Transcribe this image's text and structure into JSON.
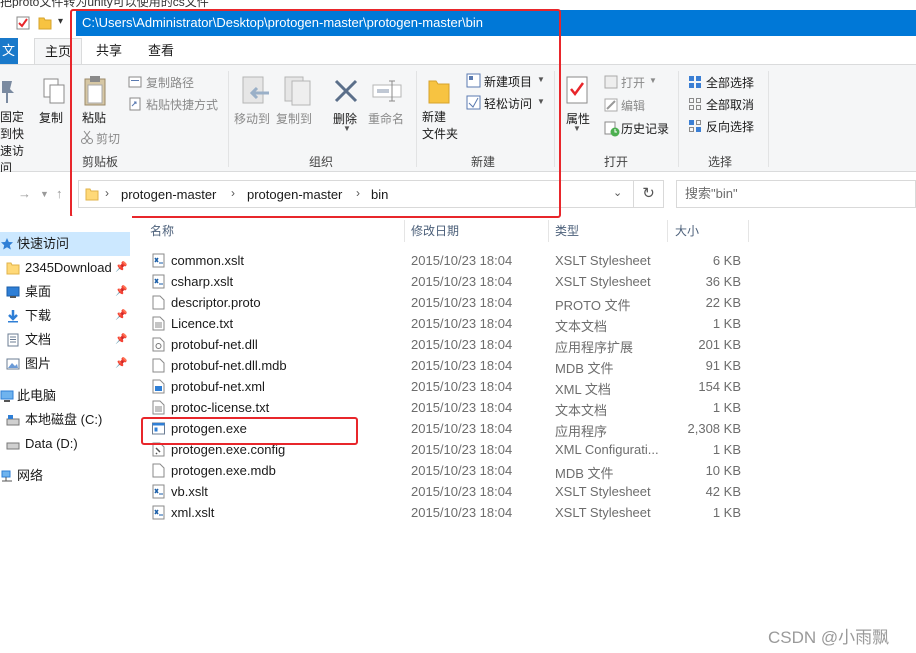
{
  "top_text": "把proto文件转为unity可以使用的cs文件",
  "title_path": "C:\\Users\\Administrator\\Desktop\\protogen-master\\protogen-master\\bin",
  "tabs": {
    "file": "文件",
    "home": "主页",
    "share": "共享",
    "view": "查看"
  },
  "ribbon": {
    "pin_quick": "固定到快速访问",
    "copy": "复制",
    "paste": "粘贴",
    "copy_path": "复制路径",
    "paste_shortcut": "粘贴快捷方式",
    "cut": "剪切",
    "clipboard": "剪贴板",
    "move_to": "移动到",
    "copy_to": "复制到",
    "delete": "删除",
    "rename": "重命名",
    "organize": "组织",
    "new_folder": "新建\n文件夹",
    "new_item": "新建项目",
    "easy_access": "轻松访问",
    "new_group": "新建",
    "properties": "属性",
    "open": "打开",
    "edit": "编辑",
    "history": "历史记录",
    "open_group": "打开",
    "select_all": "全部选择",
    "select_none": "全部取消",
    "invert": "反向选择",
    "select_group": "选择"
  },
  "address": {
    "segments": [
      "protogen-master",
      "protogen-master",
      "bin"
    ],
    "search_placeholder": "搜索\"bin\""
  },
  "nav": [
    {
      "label": "快速访问",
      "icon": "star-icon",
      "pinned": false
    },
    {
      "label": "2345Download",
      "icon": "folder-icon",
      "pinned": true
    },
    {
      "label": "桌面",
      "icon": "desktop-icon",
      "pinned": true
    },
    {
      "label": "下载",
      "icon": "download-icon",
      "pinned": true
    },
    {
      "label": "文档",
      "icon": "document-icon",
      "pinned": true
    },
    {
      "label": "图片",
      "icon": "picture-icon",
      "pinned": true
    },
    {
      "label": "此电脑",
      "icon": "computer-icon",
      "pinned": false
    },
    {
      "label": "本地磁盘 (C:)",
      "icon": "drive-icon",
      "pinned": false
    },
    {
      "label": "Data (D:)",
      "icon": "drive-icon",
      "pinned": false
    },
    {
      "label": "网络",
      "icon": "network-icon",
      "pinned": false
    }
  ],
  "columns": {
    "name": "名称",
    "date": "修改日期",
    "type": "类型",
    "size": "大小"
  },
  "files": [
    {
      "name": "common.xslt",
      "date": "2015/10/23 18:04",
      "type": "XSLT Stylesheet",
      "size": "6 KB",
      "icon": "xslt-icon"
    },
    {
      "name": "csharp.xslt",
      "date": "2015/10/23 18:04",
      "type": "XSLT Stylesheet",
      "size": "36 KB",
      "icon": "xslt-icon"
    },
    {
      "name": "descriptor.proto",
      "date": "2015/10/23 18:04",
      "type": "PROTO 文件",
      "size": "22 KB",
      "icon": "blank-file-icon"
    },
    {
      "name": "Licence.txt",
      "date": "2015/10/23 18:04",
      "type": "文本文档",
      "size": "1 KB",
      "icon": "text-file-icon"
    },
    {
      "name": "protobuf-net.dll",
      "date": "2015/10/23 18:04",
      "type": "应用程序扩展",
      "size": "201 KB",
      "icon": "dll-icon"
    },
    {
      "name": "protobuf-net.dll.mdb",
      "date": "2015/10/23 18:04",
      "type": "MDB 文件",
      "size": "91 KB",
      "icon": "blank-file-icon"
    },
    {
      "name": "protobuf-net.xml",
      "date": "2015/10/23 18:04",
      "type": "XML 文档",
      "size": "154 KB",
      "icon": "xml-icon"
    },
    {
      "name": "protoc-license.txt",
      "date": "2015/10/23 18:04",
      "type": "文本文档",
      "size": "1 KB",
      "icon": "text-file-icon"
    },
    {
      "name": "protogen.exe",
      "date": "2015/10/23 18:04",
      "type": "应用程序",
      "size": "2,308 KB",
      "icon": "exe-icon"
    },
    {
      "name": "protogen.exe.config",
      "date": "2015/10/23 18:04",
      "type": "XML Configurati...",
      "size": "1 KB",
      "icon": "config-icon"
    },
    {
      "name": "protogen.exe.mdb",
      "date": "2015/10/23 18:04",
      "type": "MDB 文件",
      "size": "10 KB",
      "icon": "blank-file-icon"
    },
    {
      "name": "vb.xslt",
      "date": "2015/10/23 18:04",
      "type": "XSLT Stylesheet",
      "size": "42 KB",
      "icon": "xslt-icon"
    },
    {
      "name": "xml.xslt",
      "date": "2015/10/23 18:04",
      "type": "XSLT Stylesheet",
      "size": "1 KB",
      "icon": "xslt-icon"
    }
  ],
  "watermark": "CSDN @小雨飘",
  "colors": {
    "title_blue": "#0078d7",
    "highlight_red": "#e8262b",
    "selection": "#cce8ff"
  }
}
